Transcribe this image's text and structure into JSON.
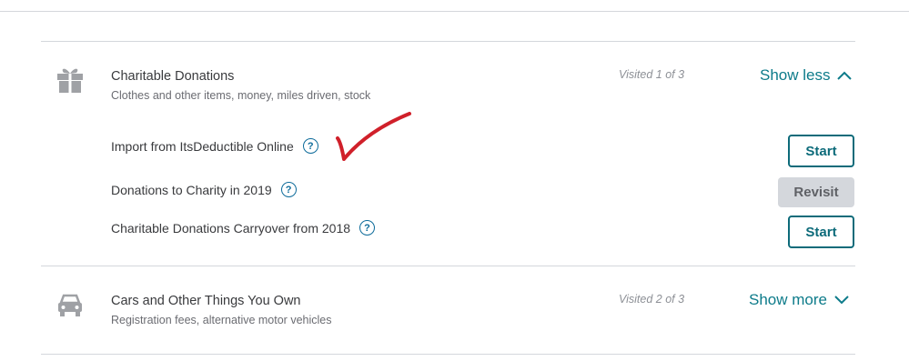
{
  "sections": [
    {
      "icon": "gift-icon",
      "title": "Charitable Donations",
      "subtitle": "Clothes and other items, money, miles driven, stock",
      "visited": "Visited 1 of 3",
      "toggle_label": "Show less",
      "toggle_icon": "chevron-up-icon",
      "items": [
        {
          "label": "Import from ItsDeductible Online",
          "button": "Start"
        },
        {
          "label": "Donations to Charity in 2019",
          "button": "Revisit"
        },
        {
          "label": "Charitable Donations Carryover from 2018",
          "button": "Start"
        }
      ]
    },
    {
      "icon": "car-icon",
      "title": "Cars and Other Things You Own",
      "subtitle": "Registration fees, alternative motor vehicles",
      "visited": "Visited 2 of 3",
      "toggle_label": "Show more",
      "toggle_icon": "chevron-down-icon"
    }
  ],
  "help_glyph": "?",
  "colors": {
    "accent": "#0d7b8a",
    "help": "#0d6b9a",
    "annotation": "#d0202a",
    "revisit_bg": "#d4d7dc"
  }
}
